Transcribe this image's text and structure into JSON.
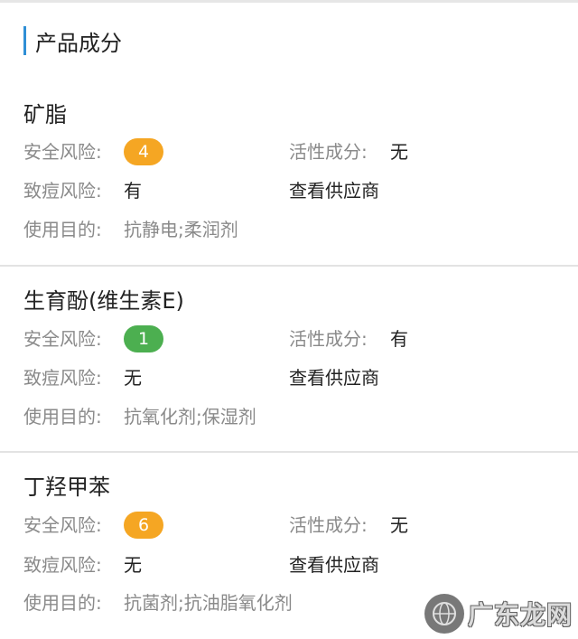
{
  "section": {
    "title": "产品成分"
  },
  "ingredients": [
    {
      "name": "矿脂",
      "safety_risk_label": "安全风险:",
      "safety_risk_value": "4",
      "safety_risk_color": "#f5a623",
      "active_label": "活性成分:",
      "active_value": "无",
      "acne_label": "致痘风险:",
      "acne_value": "有",
      "supplier_link": "查看供应商",
      "purpose_label": "使用目的:",
      "purpose_value": "抗静电;柔润剂"
    },
    {
      "name": "生育酚(维生素E)",
      "safety_risk_label": "安全风险:",
      "safety_risk_value": "1",
      "safety_risk_color": "#4caf50",
      "active_label": "活性成分:",
      "active_value": "有",
      "acne_label": "致痘风险:",
      "acne_value": "无",
      "supplier_link": "查看供应商",
      "purpose_label": "使用目的:",
      "purpose_value": "抗氧化剂;保湿剂"
    },
    {
      "name": "丁羟甲苯",
      "safety_risk_label": "安全风险:",
      "safety_risk_value": "6",
      "safety_risk_color": "#f5a623",
      "active_label": "活性成分:",
      "active_value": "无",
      "acne_label": "致痘风险:",
      "acne_value": "无",
      "supplier_link": "查看供应商",
      "purpose_label": "使用目的:",
      "purpose_value": "抗菌剂;抗油脂氧化剂"
    }
  ],
  "watermark": {
    "text": "广东龙网",
    "logo_icon": "globe-logo-icon"
  }
}
